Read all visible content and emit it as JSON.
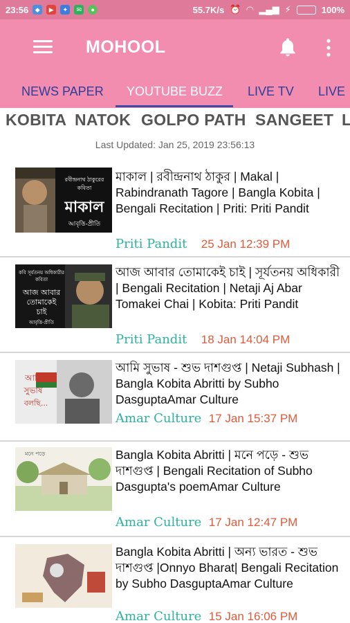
{
  "status_bar": {
    "time": "23:56",
    "network_speed": "55.7K/s",
    "battery": "100%",
    "battery_level": 1.0
  },
  "app_bar": {
    "title": "MOHOOL",
    "menu_icon": "hamburger-menu-icon",
    "bell_icon": "notification-bell-icon",
    "more_icon": "more-vertical-icon"
  },
  "tabs": [
    "NEWS PAPER",
    "YOUTUBE BUZZ",
    "LIVE TV",
    "LIVE"
  ],
  "active_tab": "YOUTUBE BUZZ",
  "subcategories": [
    "KOBITA",
    "NATOK",
    "GOLPO PATH",
    "SANGEET",
    "L"
  ],
  "last_updated": "Last Updated: Jan 25, 2019 23:56:13",
  "colors": {
    "status_bar": "#e07a9a",
    "app_bar": "#f28db0",
    "tab_text": "#2c3e9a",
    "author": "#2ab3a0",
    "date": "#e05a3a"
  },
  "videos": [
    {
      "title": "মাকাল | রবীন্দ্রনাথ ঠাকুর | Makal | Rabindranath Tagore | Bangla Kobita | Bengali Recitation | Priti: Priti Pandit",
      "author": "Priti Pandit",
      "date": "25 Jan 12:39 PM",
      "thumb_text": "মাকাল"
    },
    {
      "title": "আজ আবার তোমাকেই চাই | সূর্যতনয় অধিকারী | Bengali Recitation | Netaji Aj Abar Tomakei Chai | Kobita: Priti Pandit",
      "author": "Priti Pandit",
      "date": "18 Jan 14:04 PM",
      "thumb_text": "আজ আবার তোমাকেই চাই"
    },
    {
      "title": "আমি সুভাষ - শুভ দাশগুপ্ত | Netaji Subhash | Bangla Kobita Abritti by Subho DasguptaAmar Culture",
      "author": "Amar Culture",
      "date": "17 Jan 15:37 PM",
      "thumb_text": "আমি সুভাষ বলছি..."
    },
    {
      "title": "Bangla Kobita Abritti | মনে পড়ে - শুভ দাশগুপ্ত  | Bengali Recitation of Subho Dasgupta's poemAmar Culture",
      "author": "Amar Culture",
      "date": "17 Jan 12:47 PM",
      "thumb_text": "মনে পড়ে"
    },
    {
      "title": "Bangla Kobita Abritti | অন্য ভারত - শুভ দাশগুপ্ত |Onnyo Bharat| Bengali Recitation by Subho DasguptaAmar Culture",
      "author": "Amar Culture",
      "date": "15 Jan 16:06 PM",
      "thumb_text": ""
    }
  ]
}
